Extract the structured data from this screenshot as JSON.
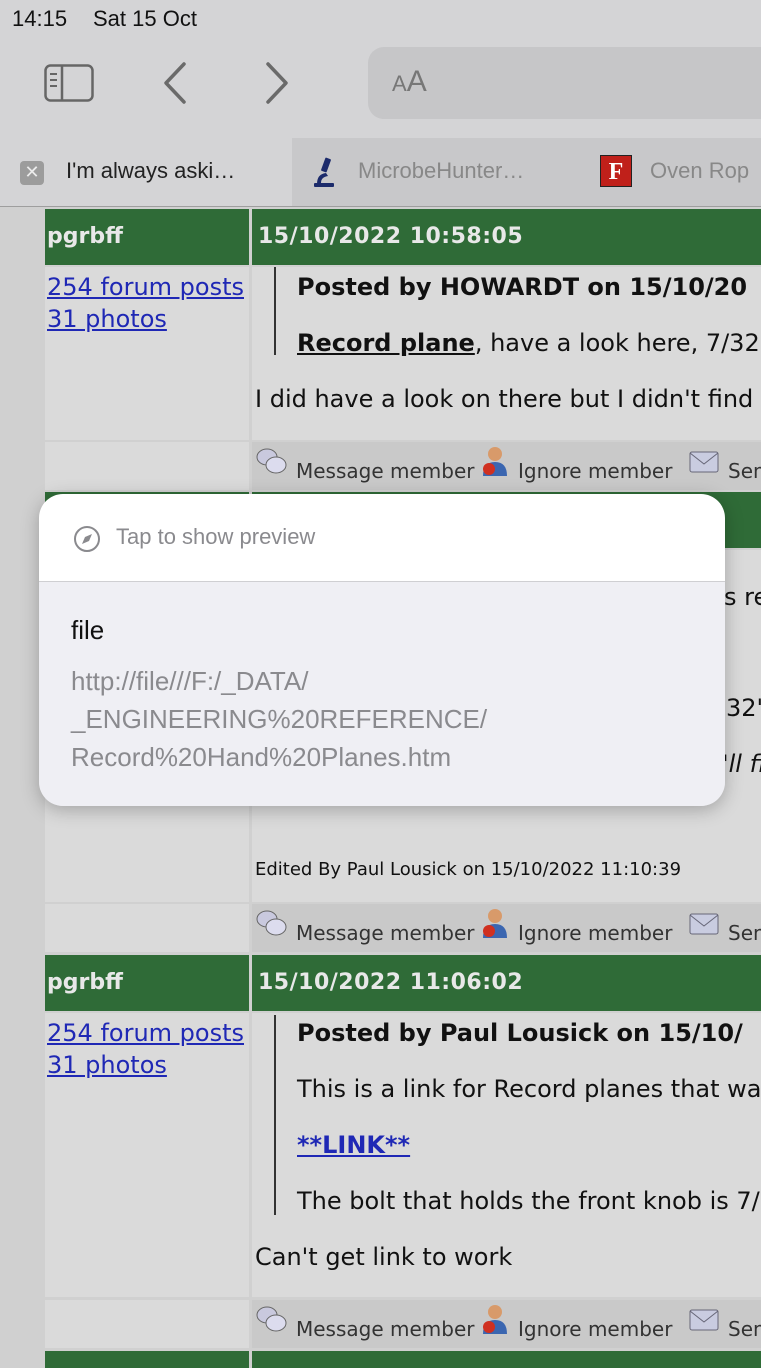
{
  "status_bar": {
    "time": "14:15",
    "date": "Sat 15 Oct"
  },
  "toolbar": {
    "address_aa_small": "A",
    "address_aa_large": "A"
  },
  "tabs": [
    {
      "title": "I'm always aski…",
      "favicon": "close-icon",
      "active": true
    },
    {
      "title": "MicrobeHunter…",
      "favicon": "microscope-icon",
      "active": false
    },
    {
      "title": "Oven Rop",
      "favicon": "F",
      "active": false
    }
  ],
  "posts": [
    {
      "author": "pgrbff",
      "datetime": "15/10/2022 10:58:05",
      "forum_posts": "254 forum posts",
      "photos": "31 photos",
      "quote_header": "Posted by HOWARDT on 15/10/20",
      "quote_link": "Record plane",
      "quote_rest": ", have a look here, 7/32",
      "reply": "I did have a look on there but I didn't find"
    },
    {
      "hidden_fragments": [
        "s re",
        "32\"",
        "'ll fi"
      ],
      "edited": "Edited By Paul Lousick on 15/10/2022 11:10:39"
    },
    {
      "author": "pgrbff",
      "datetime": "15/10/2022 11:06:02",
      "forum_posts": "254 forum posts",
      "photos": "31 photos",
      "quote_header": "Posted by Paul Lousick on 15/10/",
      "quote_line1": "This is a link for Record planes that wa",
      "quote_link": "**LINK**",
      "quote_line2": "The bolt that holds the front knob is 7/",
      "reply": "Can't get link to work"
    }
  ],
  "actions": {
    "message": "Message member",
    "ignore": "Ignore member",
    "send": "Sen"
  },
  "preview": {
    "tap": "Tap to show preview",
    "title": "file",
    "url_line1": "http://file///F:/_DATA/",
    "url_line2": "_ENGINEERING%20REFERENCE/",
    "url_line3": "Record%20Hand%20Planes.htm"
  }
}
